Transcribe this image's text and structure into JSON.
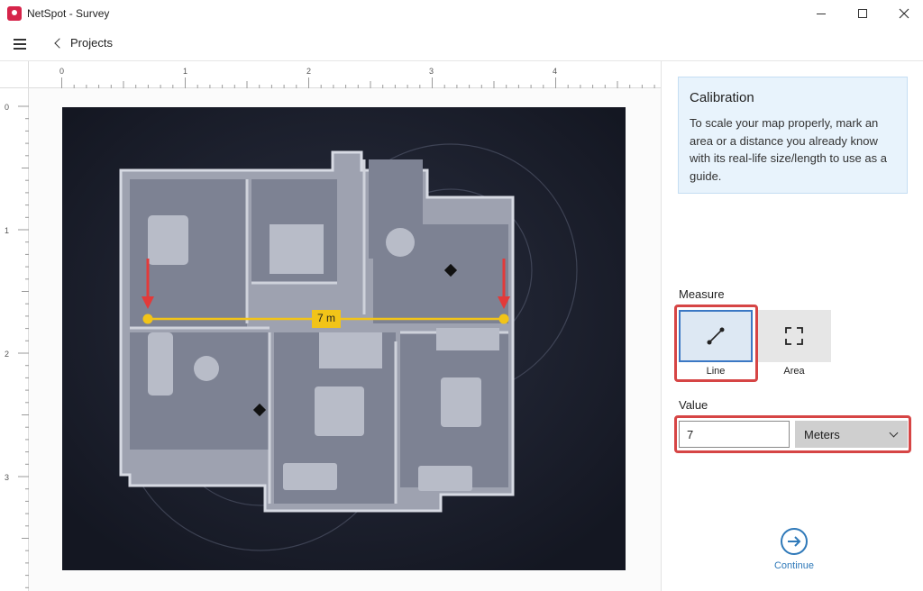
{
  "window": {
    "title": "NetSpot - Survey",
    "controls": {
      "minimize": "minimize",
      "maximize": "maximize",
      "close": "close"
    }
  },
  "nav": {
    "menu_icon": "hamburger-menu-icon",
    "back_label": "Projects"
  },
  "ruler": {
    "top_ticks": [
      "0",
      "1",
      "2",
      "3",
      "4"
    ],
    "left_ticks": [
      "0",
      "1",
      "2",
      "3"
    ]
  },
  "floorplan": {
    "measurement_label": "7 m",
    "colors": {
      "line": "#f2c418",
      "marker": "#e23a3a",
      "background": "#1a1d2a"
    }
  },
  "calibration": {
    "title": "Calibration",
    "description": "To scale your map properly, mark an area or a distance you already know with its real-life size/length to use as a guide."
  },
  "measure": {
    "label": "Measure",
    "options": [
      {
        "label": "Line",
        "icon": "line-tool-icon",
        "selected": true
      },
      {
        "label": "Area",
        "icon": "area-tool-icon",
        "selected": false
      }
    ]
  },
  "value": {
    "label": "Value",
    "input_value": "7",
    "unit_selected": "Meters"
  },
  "continue": {
    "label": "Continue",
    "icon": "arrow-right-circle-icon",
    "accent": "#2f79b9"
  }
}
